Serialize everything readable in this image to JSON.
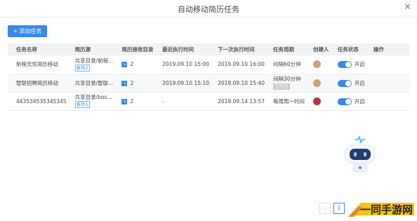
{
  "window": {
    "title": "自动移动简历任务",
    "close_glyph": "✕"
  },
  "toolbar": {
    "add_label": "添加任务",
    "add_icon": "+"
  },
  "table": {
    "headers": [
      "任务名称",
      "简历源",
      "简历接收目录",
      "最近执行时间",
      "下一次执行时间",
      "任务周期",
      "创建人",
      "任务状态",
      "操作"
    ],
    "rows": [
      {
        "name": "前程无忧简历移动",
        "source": "共享目录/前程...",
        "source_tag": "条件2",
        "dir_count": "2",
        "last_run": "2019.09.10 15:00",
        "next_run": "2019.09.10 16:00",
        "cycle": "间隔60分钟",
        "cycle_tag": "",
        "status": "开启",
        "avatar_color": "#c9a27a"
      },
      {
        "name": "智联招聘简历移动",
        "source": "共享目录/智联...",
        "source_tag": "",
        "dir_count": "2",
        "last_run": "2019.09.10 15:10",
        "next_run": "2019.09.10 15:40",
        "cycle": "间隔30分钟",
        "cycle_tag": "工作日",
        "status": "开启",
        "avatar_color": "#c9a27a"
      },
      {
        "name": "443534535345345",
        "source": "共享目录/bos...",
        "source_tag": "条件1",
        "dir_count": "2",
        "last_run": "-",
        "next_run": "2019.09.14 13:57",
        "cycle": "每周周一时间",
        "cycle_tag": "",
        "status": "开启",
        "avatar_color": "#b8323a"
      }
    ]
  },
  "pager": {
    "prev": "‹",
    "current": "1"
  },
  "watermark": {
    "text": "一同手游网"
  },
  "colors": {
    "accent": "#3c87e8",
    "header_bg": "#f2f3f5"
  }
}
